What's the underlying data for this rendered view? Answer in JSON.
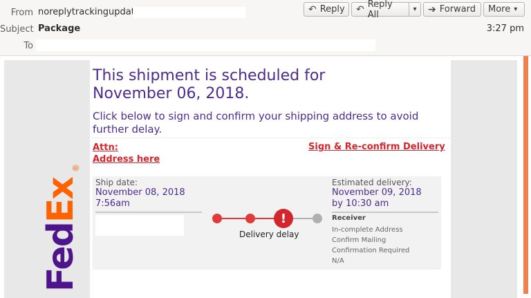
{
  "header": {
    "from_label": "From",
    "from_value": "noreplytrackingupdate",
    "subject_label": "Subject",
    "subject_value": "Package",
    "to_label": "To",
    "time": "3:27 pm",
    "buttons": {
      "reply": "Reply",
      "reply_all": "Reply All",
      "forward": "Forward",
      "more": "More"
    }
  },
  "email": {
    "headline_line1": "This shipment is scheduled for",
    "headline_line2": "November 06, 2018.",
    "sub_line1": "Click below to sign and confirm your shipping address to avoid",
    "sub_line2": "further delay.",
    "attn_line1": "Attn:",
    "attn_line2": "Address here",
    "reconfirm_link": "Sign & Re-confirm Delivery",
    "ship_date_label": "Ship date:",
    "ship_date_value": "November 08, 2018",
    "ship_time_value": "7:56am",
    "delay_label": "Delivery delay",
    "delay_icon": "!",
    "est_label": "Estimated delivery:",
    "est_date_value": "November 09, 2018",
    "est_time_value": "by 10:30 am",
    "receiver_label": "Receiver",
    "receiver_lines": [
      "In-complete Address",
      "Confirm Mailing",
      "Confirmation Required",
      "N/A"
    ],
    "logo_text": "FedEx",
    "logo_mark": "®"
  },
  "colors": {
    "purple": "#4d2b8c",
    "red": "#d2262c",
    "orange": "#f0814f",
    "fedex_purple": "#4d148c",
    "fedex_orange": "#ff6200"
  },
  "icons": [
    "reply-icon",
    "reply-all-icon",
    "dropdown-icon",
    "forward-icon",
    "chevron-down-icon",
    "alert-icon"
  ]
}
